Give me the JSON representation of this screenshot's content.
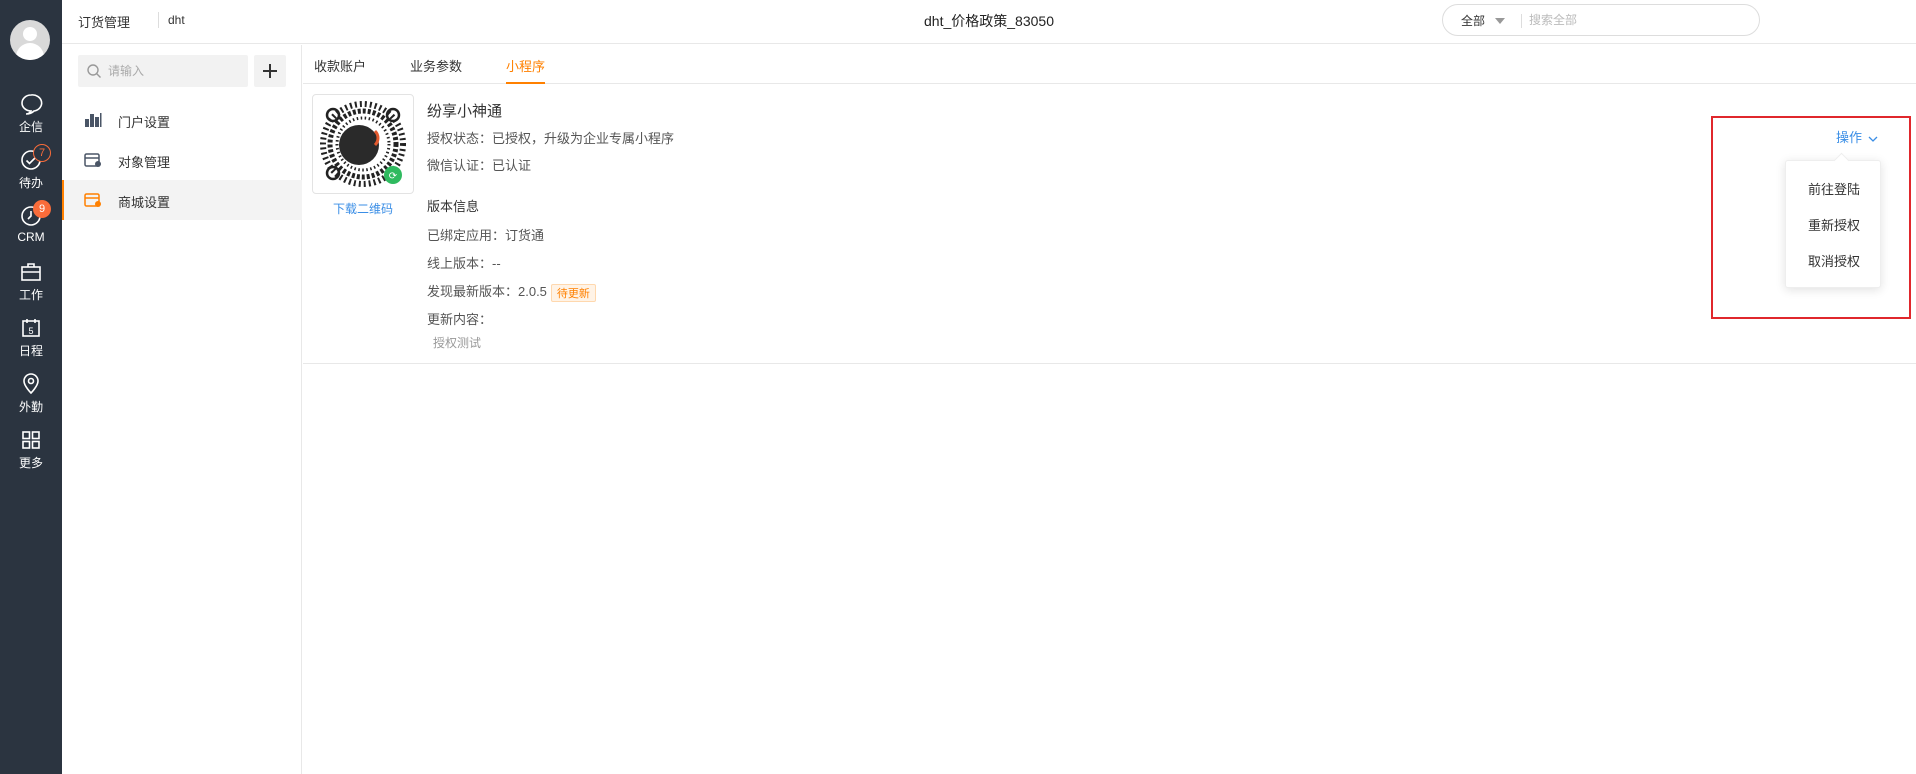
{
  "nav": {
    "items": [
      {
        "label": "企信",
        "icon": "chat-bubble-icon"
      },
      {
        "label": "待办",
        "icon": "check-circle-icon",
        "badge": "7"
      },
      {
        "label": "CRM",
        "icon": "clock-icon",
        "badge": "9"
      },
      {
        "label": "工作",
        "icon": "briefcase-icon"
      },
      {
        "label": "日程",
        "icon": "calendar-icon",
        "day": "5"
      },
      {
        "label": "外勤",
        "icon": "location-pin-icon"
      },
      {
        "label": "更多",
        "icon": "grid-icon"
      }
    ]
  },
  "topbar": {
    "crumb1": "订货管理",
    "crumb2": "dht",
    "title": "dht_价格政策_83050",
    "search_scope": "全部",
    "search_placeholder": "搜索全部"
  },
  "side": {
    "search_placeholder": "请输入",
    "items": [
      {
        "label": "门户设置",
        "icon": "bar-chart-icon"
      },
      {
        "label": "对象管理",
        "icon": "object-settings-icon"
      },
      {
        "label": "商城设置",
        "icon": "mall-settings-icon",
        "active": true
      }
    ]
  },
  "tabs": [
    {
      "label": "收款账户"
    },
    {
      "label": "业务参数"
    },
    {
      "label": "小程序",
      "active": true
    }
  ],
  "miniapp": {
    "download_qr": "下载二维码",
    "name": "纷享小神通",
    "auth_status": "授权状态：已授权，升级为企业专属小程序",
    "wechat_cert": "微信认证：已认证",
    "version_section": "版本信息",
    "bound_app": "已绑定应用：订货通",
    "online_version": "线上版本：--",
    "latest_version": "发现最新版本：2.0.5",
    "pending_tag": "待更新",
    "update_label": "更新内容：",
    "update_text": "授权测试"
  },
  "operations": {
    "label": "操作",
    "menu": [
      "前往登陆",
      "重新授权",
      "取消授权"
    ]
  },
  "colors": {
    "accent": "#ff8000",
    "link": "#3a8ee6",
    "nav_bg": "#2b3440",
    "badge": "#f96c3a",
    "highlight": "#e0272c"
  }
}
